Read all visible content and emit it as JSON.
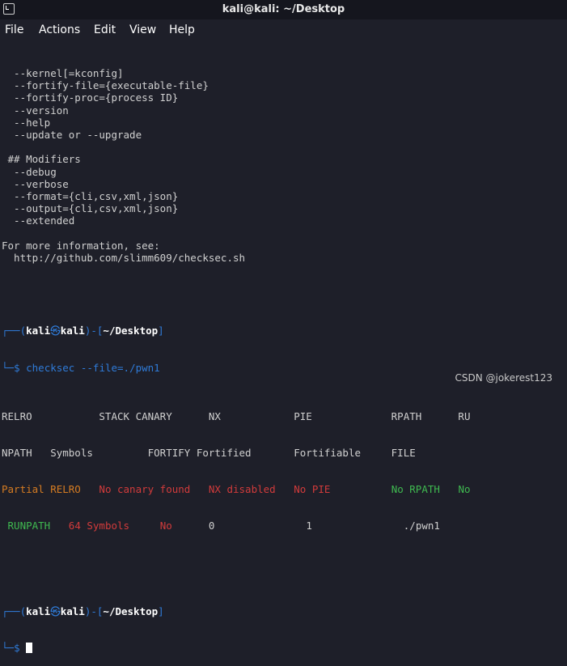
{
  "window": {
    "title": "kali@kali: ~/Desktop"
  },
  "menu": [
    "File",
    "Actions",
    "Edit",
    "View",
    "Help"
  ],
  "help_lines": [
    "  --kernel[=kconfig]",
    "  --fortify-file={executable-file}",
    "  --fortify-proc={process ID}",
    "  --version",
    "  --help",
    "  --update or --upgrade",
    "",
    " ## Modifiers",
    "  --debug",
    "  --verbose",
    "  --format={cli,csv,xml,json}",
    "  --output={cli,csv,xml,json}",
    "  --extended",
    "",
    "For more information, see:",
    "  http://github.com/slimm609/checksec.sh",
    "",
    ""
  ],
  "prompt": {
    "top_left": "┌──(",
    "user": "kali",
    "at": "㉿",
    "host": "kali",
    "close_user": ")-[",
    "path": "~/Desktop",
    "close_path": "]",
    "bottom": "└─",
    "dollar": "$"
  },
  "command": {
    "name": "checksec",
    "args": "--file=./pwn1"
  },
  "output": {
    "header1": "RELRO           STACK CANARY      NX            PIE             RPATH      RU",
    "header2": "NPATH   Symbols         FORTIFY Fortified       Fortifiable     FILE",
    "relro": "Partial RELRO",
    "canary": "No canary found",
    "nx": "NX disabled",
    "pie": "No PIE",
    "rpath": "No RPATH",
    "runpath_prefix": "No",
    "runpath": "RUNPATH",
    "symbols": "64 Symbols",
    "fortify": "No",
    "fortified": "0",
    "fortifiable": "1",
    "file": "./pwn1"
  },
  "watermark": "CSDN @jokerest123"
}
